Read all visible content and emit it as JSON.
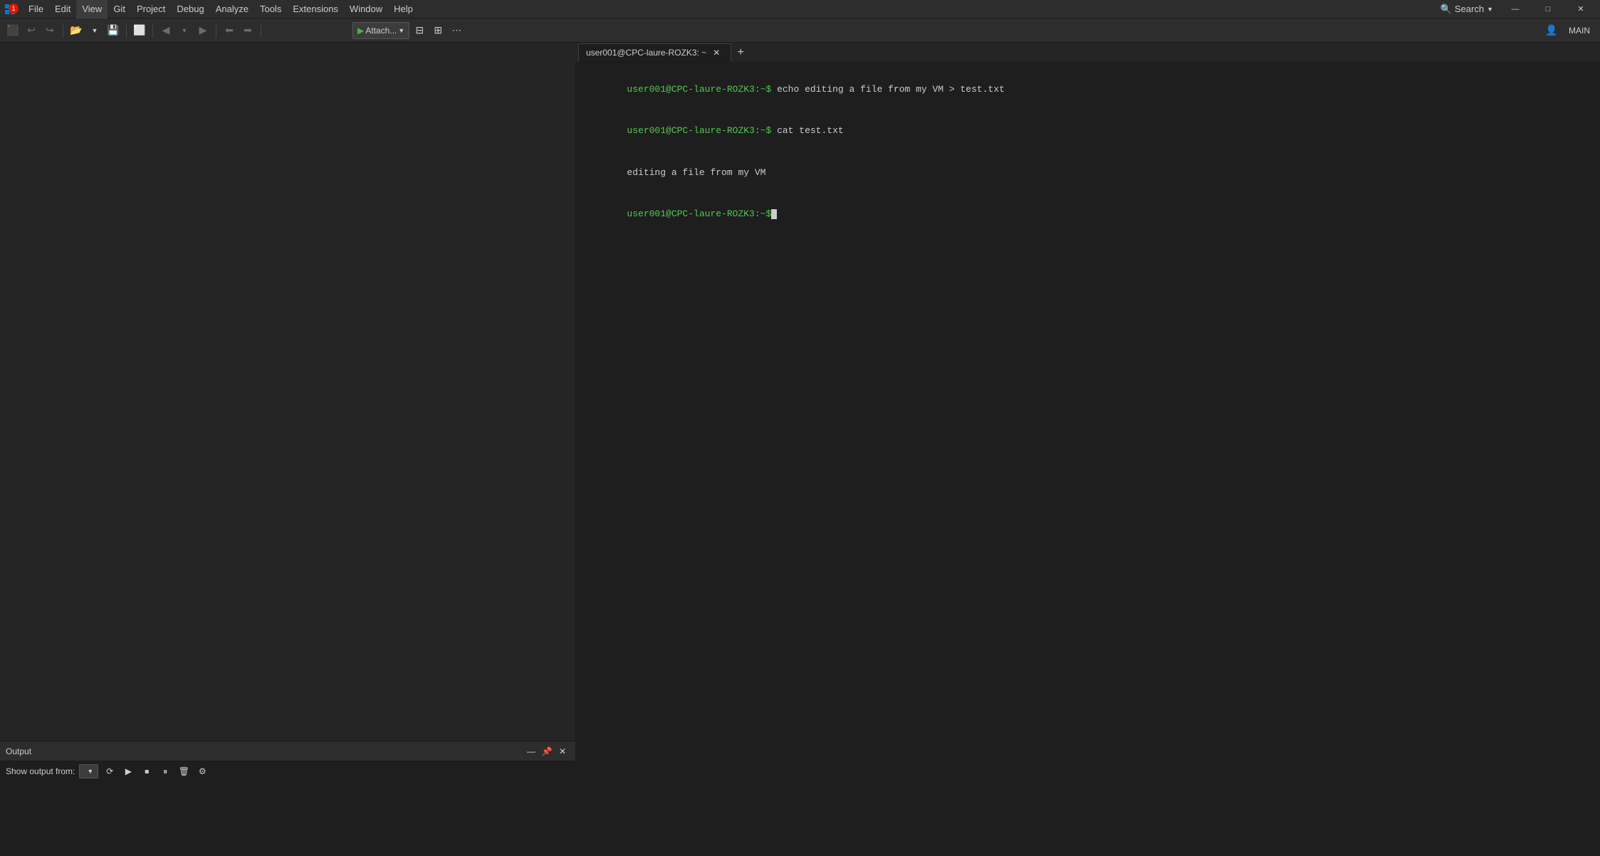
{
  "menubar": {
    "items": [
      "File",
      "Edit",
      "View",
      "Git",
      "Project",
      "Debug",
      "Analyze",
      "Tools",
      "Extensions",
      "Window",
      "Help"
    ],
    "search_label": "Search",
    "notification_count": "1"
  },
  "toolbar": {
    "attach_label": "Attach...",
    "main_label": "MAIN"
  },
  "terminal": {
    "tab_label": "user001@CPC-laure-ROZK3: ~",
    "add_button": "+",
    "lines": [
      {
        "prompt": "user001@CPC-laure-ROZK3:~$",
        "command": " echo editing a file from my VM > test.txt"
      },
      {
        "prompt": "user001@CPC-laure-ROZK3:~$",
        "command": " cat test.txt"
      },
      {
        "output": "editing a file from my VM"
      },
      {
        "prompt": "user001@CPC-laure-ROZK3:~$",
        "command": ""
      }
    ]
  },
  "output_panel": {
    "title": "Output",
    "show_output_label": "Show output from:"
  }
}
